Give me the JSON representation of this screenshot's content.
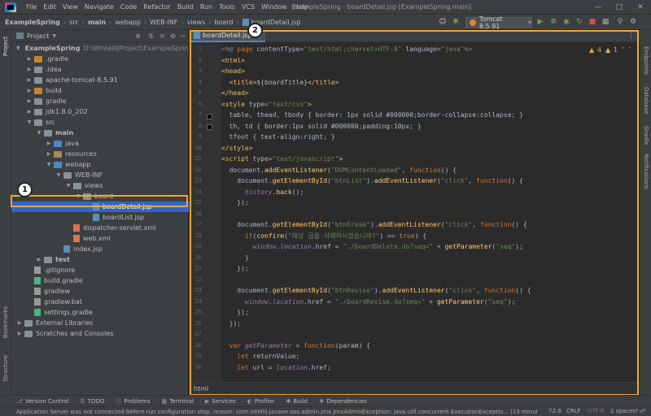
{
  "menu": [
    "File",
    "Edit",
    "View",
    "Navigate",
    "Code",
    "Refactor",
    "Build",
    "Run",
    "Tools",
    "VCS",
    "Window",
    "Help"
  ],
  "window_title": "ExampleSpring - boardDetail.jsp [ExampleSpring.main]",
  "breadcrumb": [
    "ExampleSpring",
    "src",
    "main",
    "webapp",
    "WEB-INF",
    "views",
    "board",
    "boardDetail.jsp"
  ],
  "run_config": "Tomcat 8.5.91",
  "project_panel": {
    "title": "Project",
    "tree": [
      {
        "label": "ExampleSpring",
        "extra": "D:\\WintelliJProject\\ExampleSpring",
        "indent": 0,
        "arrow": "down",
        "type": "module",
        "bold": true
      },
      {
        "label": ".gradle",
        "indent": 1,
        "arrow": "right",
        "type": "orange"
      },
      {
        "label": ".idea",
        "indent": 1,
        "arrow": "right",
        "type": "plain"
      },
      {
        "label": "apache-tomcat-8.5.91",
        "indent": 1,
        "arrow": "right",
        "type": "plain"
      },
      {
        "label": "build",
        "indent": 1,
        "arrow": "right",
        "type": "orange"
      },
      {
        "label": "gradle",
        "indent": 1,
        "arrow": "right",
        "type": "plain"
      },
      {
        "label": "jdk1.8.0_202",
        "indent": 1,
        "arrow": "right",
        "type": "plain"
      },
      {
        "label": "src",
        "indent": 1,
        "arrow": "down",
        "type": "plain"
      },
      {
        "label": "main",
        "indent": 2,
        "arrow": "down",
        "type": "plain",
        "bold": true
      },
      {
        "label": "java",
        "indent": 3,
        "arrow": "right",
        "type": "blue"
      },
      {
        "label": "resources",
        "indent": 3,
        "arrow": "right",
        "type": "res"
      },
      {
        "label": "webapp",
        "indent": 3,
        "arrow": "down",
        "type": "web"
      },
      {
        "label": "WEB-INF",
        "indent": 4,
        "arrow": "down",
        "type": "plain"
      },
      {
        "label": "views",
        "indent": 5,
        "arrow": "down",
        "type": "plain"
      },
      {
        "label": "board",
        "indent": 6,
        "arrow": "down",
        "type": "plain"
      },
      {
        "label": "boardDetail.jsp",
        "indent": 7,
        "arrow": "",
        "type": "jsp",
        "selected": true
      },
      {
        "label": "boardList.jsp",
        "indent": 7,
        "arrow": "",
        "type": "jsp"
      },
      {
        "label": "dispatcher-servlet.xml",
        "indent": 5,
        "arrow": "",
        "type": "xml"
      },
      {
        "label": "web.xml",
        "indent": 5,
        "arrow": "",
        "type": "xml"
      },
      {
        "label": "index.jsp",
        "indent": 4,
        "arrow": "",
        "type": "jsp"
      },
      {
        "label": "test",
        "indent": 2,
        "arrow": "right",
        "type": "plain",
        "bold": true
      },
      {
        "label": ".gitignore",
        "indent": 1,
        "arrow": "",
        "type": "txt"
      },
      {
        "label": "build.gradle",
        "indent": 1,
        "arrow": "",
        "type": "gradle"
      },
      {
        "label": "gradlew",
        "indent": 1,
        "arrow": "",
        "type": "txt"
      },
      {
        "label": "gradlew.bat",
        "indent": 1,
        "arrow": "",
        "type": "txt"
      },
      {
        "label": "settings.gradle",
        "indent": 1,
        "arrow": "",
        "type": "gradle"
      },
      {
        "label": "External Libraries",
        "indent": 0,
        "arrow": "right",
        "type": "lib"
      },
      {
        "label": "Scratches and Consoles",
        "indent": 0,
        "arrow": "right",
        "type": "scratch"
      }
    ]
  },
  "annotations": {
    "badge1": "1",
    "badge2": "2"
  },
  "editor": {
    "tab": "boardDetail.jsp",
    "warnings": "4",
    "weak_warnings": "1",
    "breadcrumb_footer": "html",
    "lines": [
      [
        {
          "c": "g",
          "t": "<%@ "
        },
        {
          "c": "k",
          "t": "page "
        },
        {
          "c": "",
          "t": "contentType="
        },
        {
          "c": "s",
          "t": "\"text/html;charset=UTF-8\""
        },
        {
          "c": "",
          "t": " language="
        },
        {
          "c": "s",
          "t": "\"java\""
        },
        {
          "c": "g",
          "t": "%>"
        }
      ],
      [
        {
          "c": "t",
          "t": "<html>"
        }
      ],
      [
        {
          "c": "t",
          "t": "<head>"
        }
      ],
      [
        {
          "c": "",
          "t": "  "
        },
        {
          "c": "t",
          "t": "<title>"
        },
        {
          "c": "",
          "t": "${boardTitle}"
        },
        {
          "c": "t",
          "t": "</title>"
        }
      ],
      [
        {
          "c": "t",
          "t": "</head>"
        }
      ],
      [
        {
          "c": "t",
          "t": "<style "
        },
        {
          "c": "",
          "t": "type="
        },
        {
          "c": "s",
          "t": "\"text/css\""
        },
        {
          "c": "t",
          "t": ">"
        }
      ],
      [
        {
          "c": "",
          "t": "  table, thead, tbody { border: 1px solid #000000;border-collapse:collapse; }"
        }
      ],
      [
        {
          "c": "",
          "t": "  th, td { border:1px solid #000000;padding:10px; }"
        }
      ],
      [
        {
          "c": "",
          "t": "  tfoot { text-align:right; }"
        }
      ],
      [
        {
          "c": "t",
          "t": "</style>"
        }
      ],
      [
        {
          "c": "t",
          "t": "<script "
        },
        {
          "c": "",
          "t": "type="
        },
        {
          "c": "s",
          "t": "\"text/javascript\""
        },
        {
          "c": "t",
          "t": ">"
        }
      ],
      [
        {
          "c": "",
          "t": "  document."
        },
        {
          "c": "f",
          "t": "addEventListener"
        },
        {
          "c": "",
          "t": "("
        },
        {
          "c": "s",
          "t": "\"DOMContentLoaded\""
        },
        {
          "c": "",
          "t": ", "
        },
        {
          "c": "k",
          "t": "function"
        },
        {
          "c": "",
          "t": "() {"
        }
      ],
      [
        {
          "c": "",
          "t": "    document."
        },
        {
          "c": "f",
          "t": "getElementById"
        },
        {
          "c": "",
          "t": "("
        },
        {
          "c": "s",
          "t": "\"btnList\""
        },
        {
          "c": "",
          "t": ")."
        },
        {
          "c": "f",
          "t": "addEventListener"
        },
        {
          "c": "",
          "t": "("
        },
        {
          "c": "s",
          "t": "\"click\""
        },
        {
          "c": "",
          "t": ", "
        },
        {
          "c": "k",
          "t": "function"
        },
        {
          "c": "",
          "t": "() {"
        }
      ],
      [
        {
          "c": "",
          "t": "      "
        },
        {
          "c": "p",
          "t": "history"
        },
        {
          "c": "",
          "t": "."
        },
        {
          "c": "f",
          "t": "back"
        },
        {
          "c": "",
          "t": "();"
        }
      ],
      [
        {
          "c": "",
          "t": "    });"
        }
      ],
      [
        {
          "c": "",
          "t": ""
        }
      ],
      [
        {
          "c": "",
          "t": "    document."
        },
        {
          "c": "f",
          "t": "getElementById"
        },
        {
          "c": "",
          "t": "("
        },
        {
          "c": "s",
          "t": "\"btnErase\""
        },
        {
          "c": "",
          "t": ")."
        },
        {
          "c": "f",
          "t": "addEventListener"
        },
        {
          "c": "",
          "t": "("
        },
        {
          "c": "s",
          "t": "\"click\""
        },
        {
          "c": "",
          "t": ", "
        },
        {
          "c": "k",
          "t": "function"
        },
        {
          "c": "",
          "t": "() {"
        }
      ],
      [
        {
          "c": "",
          "t": "      "
        },
        {
          "c": "k",
          "t": "if"
        },
        {
          "c": "",
          "t": "("
        },
        {
          "c": "f",
          "t": "confirm"
        },
        {
          "c": "",
          "t": "("
        },
        {
          "c": "s",
          "t": "\"해당 글을 삭제하시겠습니까?\""
        },
        {
          "c": "",
          "t": ") == "
        },
        {
          "c": "k",
          "t": "true"
        },
        {
          "c": "",
          "t": ") {"
        }
      ],
      [
        {
          "c": "",
          "t": "        "
        },
        {
          "c": "p",
          "t": "window"
        },
        {
          "c": "",
          "t": "."
        },
        {
          "c": "p",
          "t": "location"
        },
        {
          "c": "",
          "t": ".href = "
        },
        {
          "c": "s",
          "t": "\"./boardDelete.do?seq=\""
        },
        {
          "c": "",
          "t": " + "
        },
        {
          "c": "f",
          "t": "getParameter"
        },
        {
          "c": "",
          "t": "("
        },
        {
          "c": "s",
          "t": "\"seq\""
        },
        {
          "c": "",
          "t": ");"
        }
      ],
      [
        {
          "c": "",
          "t": "      }"
        }
      ],
      [
        {
          "c": "",
          "t": "    });"
        }
      ],
      [
        {
          "c": "",
          "t": ""
        }
      ],
      [
        {
          "c": "",
          "t": "    document."
        },
        {
          "c": "f",
          "t": "getElementById"
        },
        {
          "c": "",
          "t": "("
        },
        {
          "c": "s",
          "t": "\"btnRevise\""
        },
        {
          "c": "",
          "t": ")."
        },
        {
          "c": "f",
          "t": "addEventListener"
        },
        {
          "c": "",
          "t": "("
        },
        {
          "c": "s",
          "t": "\"click\""
        },
        {
          "c": "",
          "t": ", "
        },
        {
          "c": "k",
          "t": "function"
        },
        {
          "c": "",
          "t": "() {"
        }
      ],
      [
        {
          "c": "",
          "t": "      "
        },
        {
          "c": "p",
          "t": "window"
        },
        {
          "c": "",
          "t": "."
        },
        {
          "c": "p",
          "t": "location"
        },
        {
          "c": "",
          "t": ".href = "
        },
        {
          "c": "s",
          "t": "\"./boardRevise.do?seq=\""
        },
        {
          "c": "",
          "t": " + "
        },
        {
          "c": "f",
          "t": "getParameter"
        },
        {
          "c": "",
          "t": "("
        },
        {
          "c": "s",
          "t": "\"seq\""
        },
        {
          "c": "",
          "t": ");"
        }
      ],
      [
        {
          "c": "",
          "t": "    });"
        }
      ],
      [
        {
          "c": "",
          "t": "  });"
        }
      ],
      [
        {
          "c": "",
          "t": ""
        }
      ],
      [
        {
          "c": "",
          "t": "  "
        },
        {
          "c": "k",
          "t": "var "
        },
        {
          "c": "p",
          "t": "getParameter"
        },
        {
          "c": "",
          "t": " = "
        },
        {
          "c": "k",
          "t": "function"
        },
        {
          "c": "",
          "t": "(param) {"
        }
      ],
      [
        {
          "c": "",
          "t": "    "
        },
        {
          "c": "k",
          "t": "let "
        },
        {
          "c": "",
          "t": "returnValue;"
        }
      ],
      [
        {
          "c": "",
          "t": "    "
        },
        {
          "c": "k",
          "t": "let "
        },
        {
          "c": "",
          "t": "url = "
        },
        {
          "c": "p",
          "t": "location"
        },
        {
          "c": "",
          "t": ".href;"
        }
      ]
    ]
  },
  "right_stripe": [
    "Endpoints",
    "Database",
    "Gradle",
    "Notifications"
  ],
  "left_stripe": [
    "Project",
    "Bookmarks",
    "Structure"
  ],
  "bottom_tools": [
    "Version Control",
    "TODO",
    "Problems",
    "Terminal",
    "Services",
    "Profiler",
    "Build",
    "Dependencies"
  ],
  "status": {
    "message": "Application Server was not connected before run configuration stop, reason: com.intellij.javaee.oss.admin.jmx.JmxAdminException: java.util.concurrent.ExecutionExceptio... (13 minutes a",
    "position": "72:8",
    "line_sep": "CRLF",
    "encoding": "UTF-8",
    "indent": "2 spaces*"
  },
  "colors": {
    "highlight": "#f5a623",
    "selection": "#2f65ca",
    "keyword": "#cc7832",
    "string": "#6a8759",
    "tag": "#e8bf6a"
  }
}
